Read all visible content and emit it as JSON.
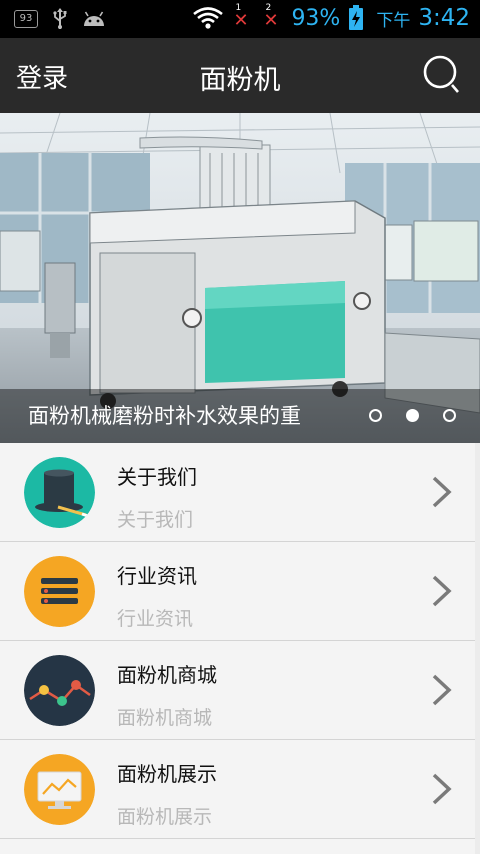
{
  "status_bar": {
    "badge": "93",
    "sim1": "1",
    "sim2": "2",
    "battery": "93%",
    "ampm": "下午",
    "time": "3:42"
  },
  "header": {
    "login_label": "登录",
    "title": "面粉机"
  },
  "banner": {
    "caption": "面粉机械磨粉时补水效果的重",
    "slide_count": 3,
    "active_slide": 2
  },
  "list": {
    "items": [
      {
        "title": "关于我们",
        "subtitle": "关于我们",
        "icon": "top-hat-icon",
        "color": "#1cb9a4"
      },
      {
        "title": "行业资讯",
        "subtitle": "行业资讯",
        "icon": "list-icon",
        "color": "#f5a623"
      },
      {
        "title": "面粉机商城",
        "subtitle": "面粉机商城",
        "icon": "line-graph-icon",
        "color": "#253545"
      },
      {
        "title": "面粉机展示",
        "subtitle": "面粉机展示",
        "icon": "monitor-chart-icon",
        "color": "#f5a623"
      }
    ]
  }
}
